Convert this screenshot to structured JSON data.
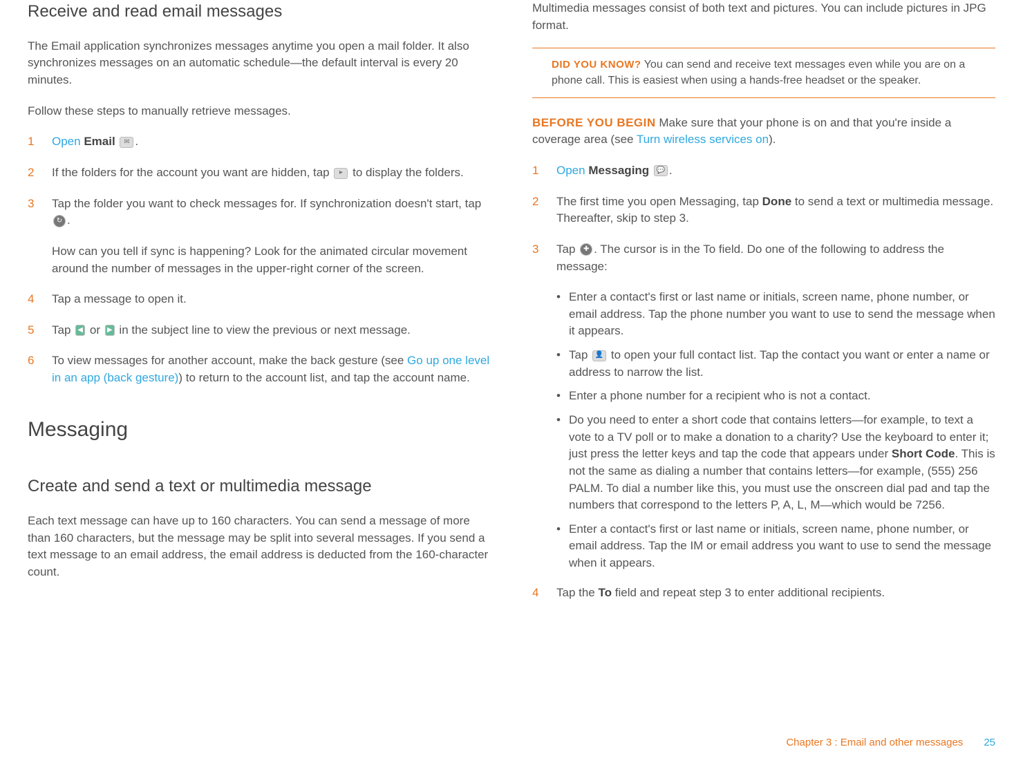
{
  "left": {
    "h1": "Receive and read email messages",
    "p1": "The Email application synchronizes messages anytime you open a mail folder. It also synchronizes messages on an automatic schedule—the default interval is every 20 minutes.",
    "p2": "Follow these steps to manually retrieve messages.",
    "s1_open": "Open",
    "s1_app": "Email",
    "s2a": "If the folders for the account you want are hidden, tap ",
    "s2b": " to display the folders.",
    "s3a": "Tap the folder you want to check messages for. If synchronization doesn't start, tap ",
    "s3b": ".",
    "s3c": "How can you tell if sync is happening? Look for the animated circular movement around the number of messages in the upper-right corner of the screen.",
    "s4": "Tap a message to open it.",
    "s5a": "Tap ",
    "s5b": " or ",
    "s5c": " in the subject line to view the previous or next message.",
    "s6a": "To view messages for another account, make the back gesture (see ",
    "s6link": "Go up one level in an app (back gesture)",
    "s6b": ") to return to the account list, and tap the account name.",
    "h2": "Messaging",
    "h3": "Create and send a text or multimedia message",
    "p3": "Each text message can have up to 160 characters. You can send a message of more than 160 characters, but the message may be split into several messages. If you send a text message to an email address, the email address is deducted from the 160-character count."
  },
  "right": {
    "p0": "Multimedia messages consist of both text and pictures. You can include pictures in JPG format.",
    "dyk_label": "did you know?",
    "dyk_text": "  You can send and receive text messages even while you are on a phone call. This is easiest when using a hands-free headset or the speaker.",
    "byb_label": "BEFORE YOU BEGIN",
    "byb_a": "  Make sure that your phone is on and that you're inside a coverage area (see ",
    "byb_link": "Turn wireless services on",
    "byb_b": ").",
    "s1_open": "Open",
    "s1_app": "Messaging",
    "s2a": "The first time you open Messaging, tap ",
    "s2done": "Done",
    "s2b": " to send a text or multimedia message. Thereafter, skip to step 3.",
    "s3a": "Tap ",
    "s3b": ". The cursor is in the To field. Do one of the following to address the message:",
    "b1": "Enter a contact's first or last name or initials, screen name, phone number, or email address. Tap the phone number you want to use to send the message when it appears.",
    "b2a": "Tap ",
    "b2b": " to open your full contact list. Tap the contact you want or enter a name or address to narrow the list.",
    "b3": "Enter a phone number for a recipient who is not a contact.",
    "b4a": "Do you need to enter a short code that contains letters—for example, to text a vote to a TV poll or to make a donation to a charity? Use the keyboard to enter it; just press the letter keys and tap the code that appears under ",
    "b4sc": "Short Code",
    "b4b": ". This is not the same as dialing a number that contains letters—for example, (555) 256 PALM. To dial a number like this, you must use the onscreen dial pad and tap the numbers that correspond to the letters P, A, L, M—which would be 7256.",
    "b5": "Enter a contact's first or last name or initials, screen name, phone number, or email address. Tap the IM or email address you want to use to send the message when it appears.",
    "s4a": "Tap the ",
    "s4to": "To",
    "s4b": " field and repeat step 3 to enter additional recipients."
  },
  "footer": {
    "chapter": "Chapter 3  :  Email and other messages",
    "page": "25"
  }
}
